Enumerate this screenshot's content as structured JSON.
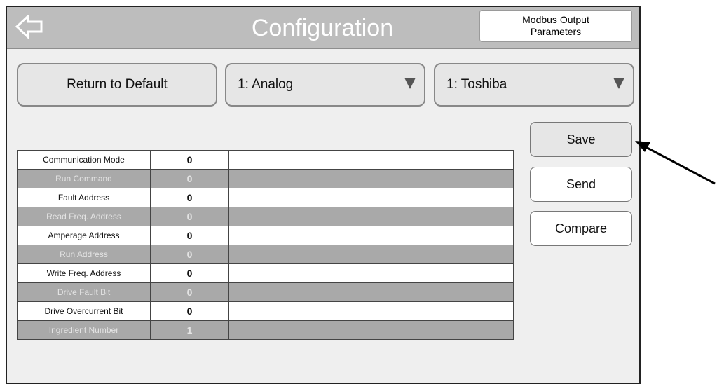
{
  "header": {
    "title": "Configuration",
    "modbus_button": "Modbus Output Parameters"
  },
  "controls": {
    "return_default": "Return to Default",
    "mode_dropdown": "1: Analog",
    "drive_dropdown": "1: Toshiba"
  },
  "actions": {
    "save": "Save",
    "send": "Send",
    "compare": "Compare"
  },
  "table": {
    "rows": [
      {
        "label": "Communication Mode",
        "value": "0"
      },
      {
        "label": "Run Command",
        "value": "0"
      },
      {
        "label": "Fault Address",
        "value": "0"
      },
      {
        "label": "Read Freq. Address",
        "value": "0"
      },
      {
        "label": "Amperage Address",
        "value": "0"
      },
      {
        "label": "Run Address",
        "value": "0"
      },
      {
        "label": "Write Freq. Address",
        "value": "0"
      },
      {
        "label": "Drive Fault Bit",
        "value": "0"
      },
      {
        "label": "Drive Overcurrent Bit",
        "value": "0"
      },
      {
        "label": "Ingredient Number",
        "value": "1"
      }
    ]
  },
  "colors": {
    "header_bg": "#bdbdbd",
    "alt_row": "#a9a9a9",
    "button_bg": "#e6e6e6"
  }
}
